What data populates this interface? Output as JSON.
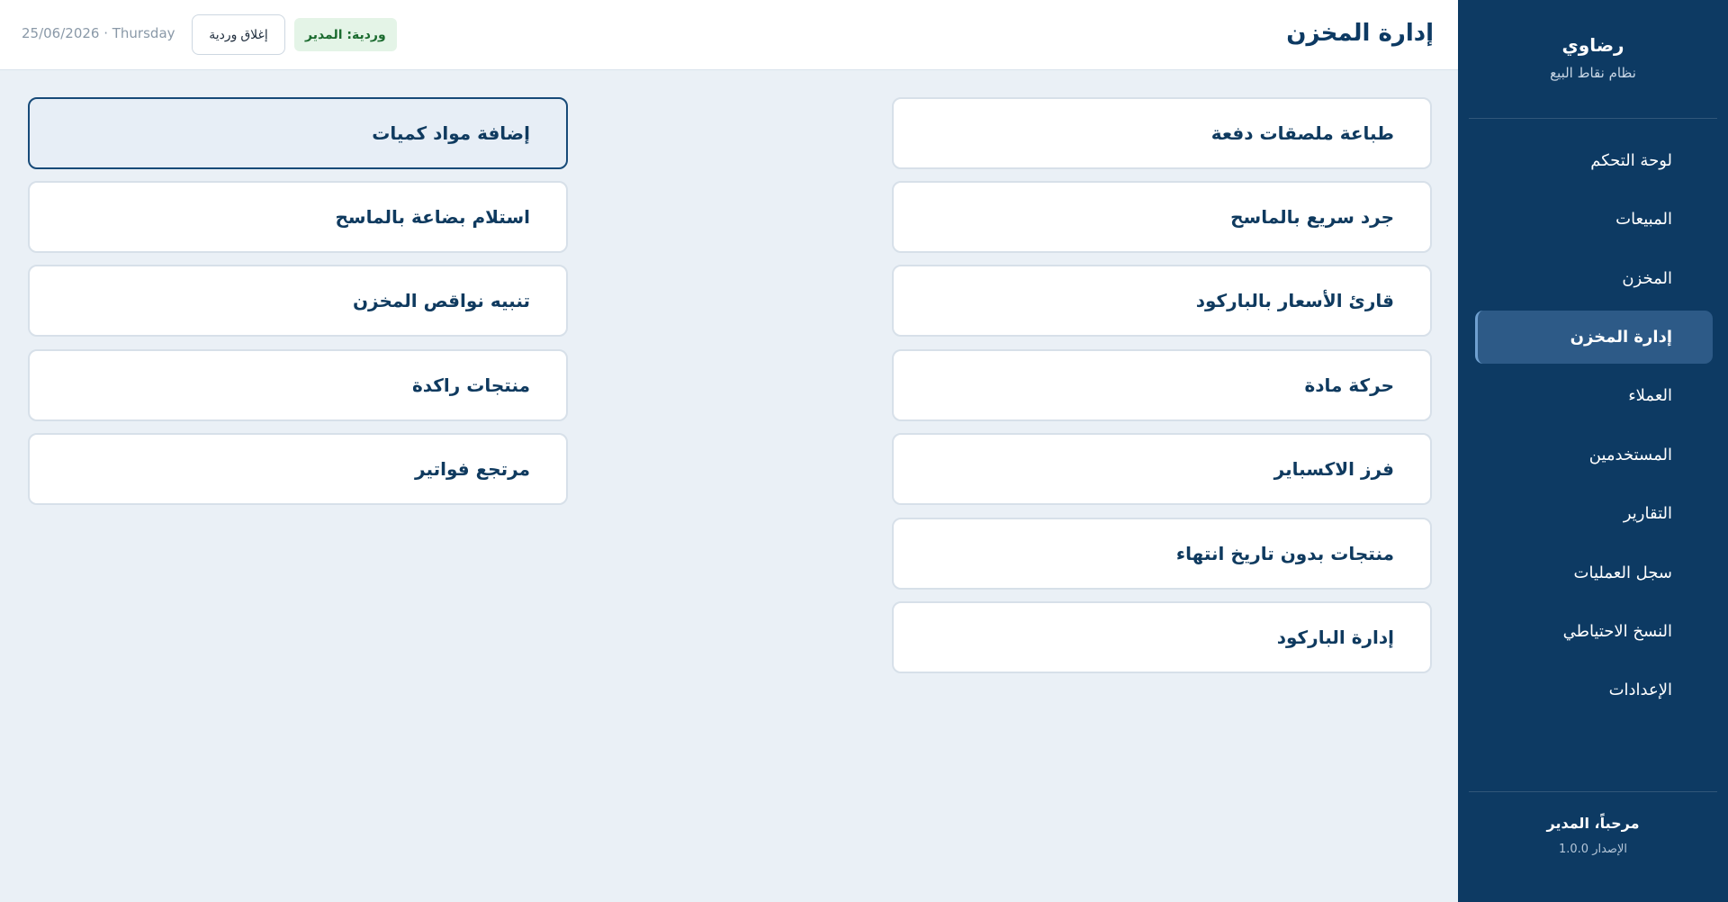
{
  "sidebar": {
    "brand": {
      "name": "رضاوي",
      "subtitle": "نظام نقاط البيع"
    },
    "items": [
      {
        "label": "لوحة التحكم",
        "icon": "dashboard-icon"
      },
      {
        "label": "المبيعات",
        "icon": "sales-icon"
      },
      {
        "label": "المخزن",
        "icon": "warehouse-icon"
      },
      {
        "label": "إدارة المخزن",
        "icon": "inventory-icon",
        "active": true
      },
      {
        "label": "العملاء",
        "icon": "customers-icon"
      },
      {
        "label": "المستخدمين",
        "icon": "users-icon"
      },
      {
        "label": "التقارير",
        "icon": "reports-icon"
      },
      {
        "label": "سجل العمليات",
        "icon": "log-icon"
      },
      {
        "label": "النسخ الاحتياطي",
        "icon": "backup-icon"
      },
      {
        "label": "الإعدادات",
        "icon": "settings-icon"
      }
    ],
    "footer": {
      "welcome": "مرحباً، المدير",
      "version": "الإصدار 1.0.0"
    }
  },
  "header": {
    "title": "إدارة المخزن",
    "shift_badge": "وردية: المدير",
    "close_shift": "إغلاق وردية",
    "date": "25/06/2026 · Thursday"
  },
  "main": {
    "right_column": [
      "طباعة ملصقات دفعة",
      "جرد سريع بالماسح",
      "قارئ الأسعار بالباركود",
      "حركة مادة",
      "فرز الاكسباير",
      "منتجات بدون تاريخ انتهاء",
      "إدارة الباركود"
    ],
    "left_column": [
      "إضافة مواد كميات",
      "استلام بضاعة بالماسح",
      "تنبيه نواقص المخزن",
      "منتجات راكدة",
      "مرتجع فواتير"
    ],
    "selected_left_index": 0
  },
  "colors": {
    "sidebar_bg": "#0d3a63",
    "active_item_bg": "#2d5a87",
    "content_bg": "#eaf0f6",
    "badge_bg": "#e4f4e7",
    "badge_text": "#1b6b2f"
  }
}
